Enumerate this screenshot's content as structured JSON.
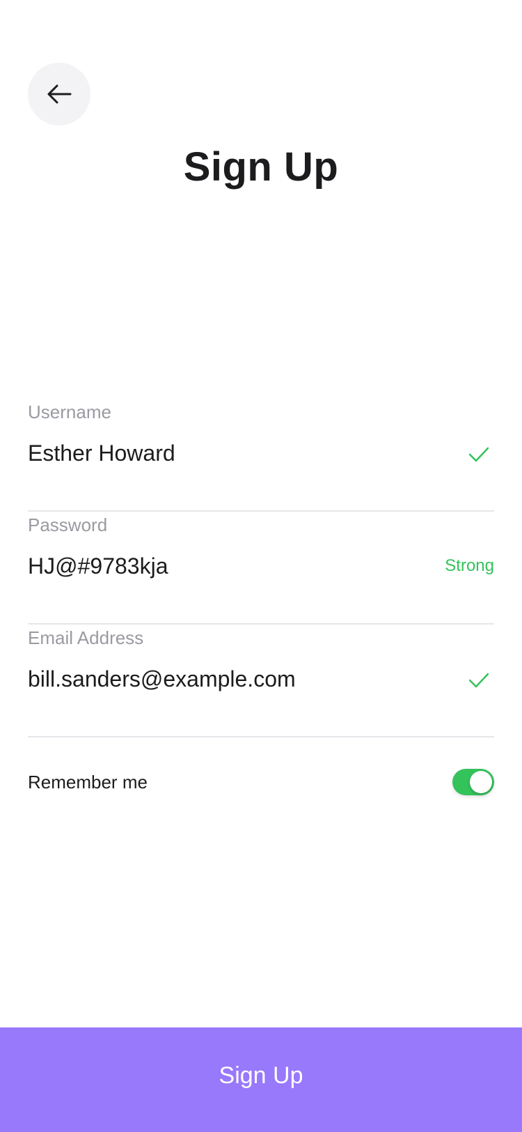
{
  "header": {
    "back_icon": "arrow-left-icon",
    "title": "Sign Up"
  },
  "form": {
    "username": {
      "label": "Username",
      "value": "Esther Howard",
      "status_icon": "check-icon"
    },
    "password": {
      "label": "Password",
      "value": "HJ@#9783kja",
      "strength": "Strong"
    },
    "email": {
      "label": "Email Address",
      "value": "bill.sanders@example.com",
      "status_icon": "check-icon"
    }
  },
  "remember": {
    "label": "Remember me",
    "enabled": true
  },
  "submit": {
    "label": "Sign Up"
  },
  "colors": {
    "accent": "#9878fb",
    "success": "#34c25b",
    "label": "#9a9aa2",
    "text": "#1c1c1e",
    "divider": "#e6e6ea",
    "back_bg": "#f3f3f6"
  }
}
